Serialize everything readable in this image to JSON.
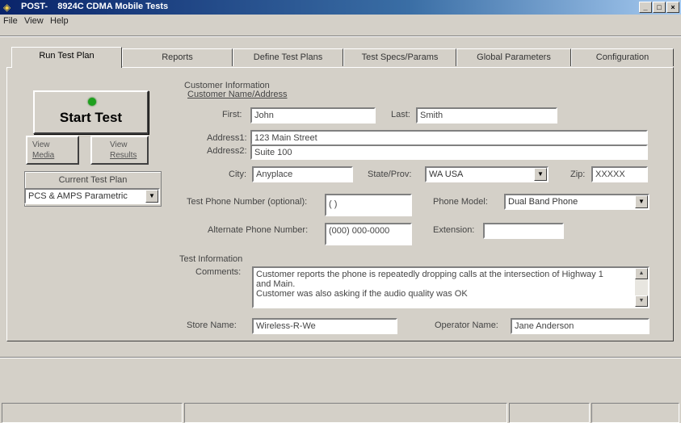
{
  "window": {
    "title": "POST-    8924C CDMA Mobile Tests"
  },
  "menu": [
    {
      "label": "File"
    },
    {
      "label": "View"
    },
    {
      "label": "Help"
    }
  ],
  "tabs": [
    {
      "label": "Run Test Plan",
      "active": true
    },
    {
      "label": "Reports"
    },
    {
      "label": "Define Test Plans"
    },
    {
      "label": "Test Specs/Params"
    },
    {
      "label": "Global Parameters"
    },
    {
      "label": "Configuration"
    }
  ],
  "left_panel": {
    "start_label": "Start Test",
    "led_color": "#1ea01e",
    "view_media": {
      "line1": "View",
      "line2": "Media"
    },
    "view_results": {
      "line1": "View",
      "line2": "Results"
    },
    "current_plan_title": "Current Test Plan",
    "current_plan_value": "PCS & AMPS Parametric"
  },
  "customer": {
    "section_title": "Customer Information",
    "subsection_title": "Customer Name/Address",
    "first_label": "First:",
    "first_value": "John",
    "last_label": "Last:",
    "last_value": "Smith",
    "address1_label": "Address1:",
    "address1_value": "123 Main Street",
    "address2_label": "Address2:",
    "address2_value": "Suite 100",
    "city_label": "City:",
    "city_value": "Anyplace",
    "state_label": "State/Prov:",
    "state_value": "WA USA",
    "zip_label": "Zip:",
    "zip_value": "XXXXX",
    "test_phone_label": "Test Phone Number (optional):",
    "test_phone_value": "(  )",
    "phone_model_label": "Phone Model:",
    "phone_model_value": "Dual Band Phone",
    "alt_phone_label": "Alternate Phone Number:",
    "alt_phone_value": "(000) 000-0000",
    "extension_label": "Extension:",
    "extension_value": ""
  },
  "test_info": {
    "section_title": "Test Information",
    "comments_label": "Comments:",
    "comments_lines": [
      "Customer reports the phone is repeatedly dropping calls at the intersection of Highway 1",
      "and Main.",
      "Customer was also asking if the audio quality was OK"
    ],
    "store_label": "Store Name:",
    "store_value": "Wireless-R-We",
    "operator_label": "Operator Name:",
    "operator_value": "Jane Anderson"
  }
}
